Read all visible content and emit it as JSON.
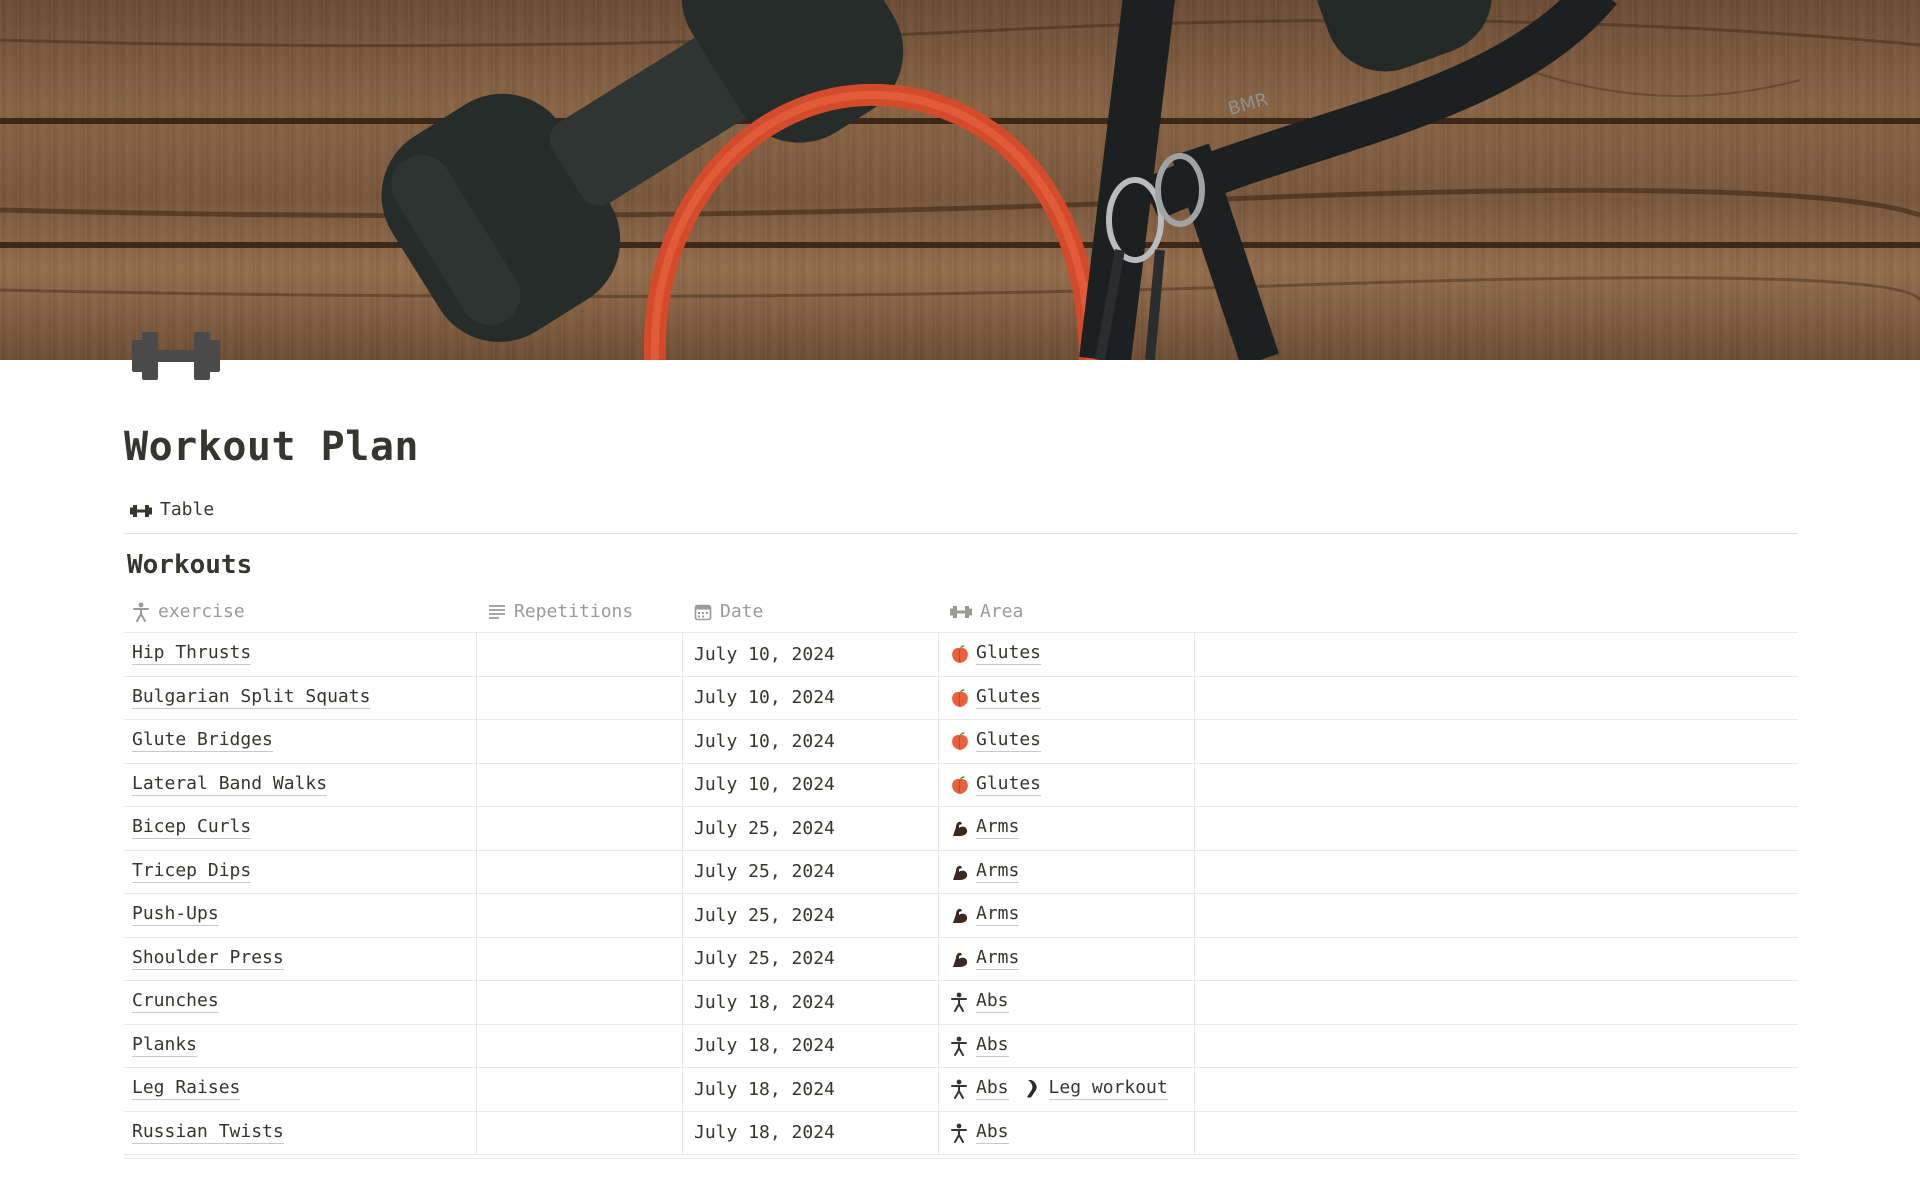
{
  "page": {
    "title": "Workout Plan",
    "icon": "dumbbell-icon",
    "cover": "dumbbells-and-resistance-band-on-wood-photo"
  },
  "views": [
    {
      "label": "Table",
      "icon": "dumbbell-icon"
    }
  ],
  "database": {
    "title": "Workouts",
    "columns": [
      {
        "label": "exercise",
        "icon": "person-icon"
      },
      {
        "label": "Repetitions",
        "icon": "text-lines-icon"
      },
      {
        "label": "Date",
        "icon": "calendar-icon"
      },
      {
        "label": "Area",
        "icon": "dumbbell-icon"
      }
    ],
    "rows": [
      {
        "exercise": "Hip Thrusts",
        "repetitions": "",
        "date": "July 10, 2024",
        "area": [
          {
            "label": "Glutes",
            "icon": "peach-icon"
          }
        ]
      },
      {
        "exercise": "Bulgarian Split Squats",
        "repetitions": "",
        "date": "July 10, 2024",
        "area": [
          {
            "label": "Glutes",
            "icon": "peach-icon"
          }
        ]
      },
      {
        "exercise": "Glute Bridges",
        "repetitions": "",
        "date": "July 10, 2024",
        "area": [
          {
            "label": "Glutes",
            "icon": "peach-icon"
          }
        ]
      },
      {
        "exercise": "Lateral Band Walks",
        "repetitions": "",
        "date": "July 10, 2024",
        "area": [
          {
            "label": "Glutes",
            "icon": "peach-icon"
          }
        ]
      },
      {
        "exercise": "Bicep Curls",
        "repetitions": "",
        "date": "July 25, 2024",
        "area": [
          {
            "label": "Arms",
            "icon": "flexed-bicep-icon"
          }
        ]
      },
      {
        "exercise": "Tricep Dips",
        "repetitions": "",
        "date": "July 25, 2024",
        "area": [
          {
            "label": "Arms",
            "icon": "flexed-bicep-icon"
          }
        ]
      },
      {
        "exercise": "Push-Ups",
        "repetitions": "",
        "date": "July 25, 2024",
        "area": [
          {
            "label": "Arms",
            "icon": "flexed-bicep-icon"
          }
        ]
      },
      {
        "exercise": "Shoulder Press",
        "repetitions": "",
        "date": "July 25, 2024",
        "area": [
          {
            "label": "Arms",
            "icon": "flexed-bicep-icon"
          }
        ]
      },
      {
        "exercise": "Crunches",
        "repetitions": "",
        "date": "July 18, 2024",
        "area": [
          {
            "label": "Abs",
            "icon": "person-icon"
          }
        ]
      },
      {
        "exercise": "Planks",
        "repetitions": "",
        "date": "July 18, 2024",
        "area": [
          {
            "label": "Abs",
            "icon": "person-icon"
          }
        ]
      },
      {
        "exercise": "Leg Raises",
        "repetitions": "",
        "date": "July 18, 2024",
        "area": [
          {
            "label": "Abs",
            "icon": "person-icon"
          },
          {
            "label": "Leg workout",
            "icon": "leg-icon"
          }
        ]
      },
      {
        "exercise": "Russian Twists",
        "repetitions": "",
        "date": "July 18, 2024",
        "area": [
          {
            "label": "Abs",
            "icon": "person-icon"
          }
        ]
      }
    ]
  },
  "colors": {
    "text": "#37352f",
    "muted": "#9b9a97",
    "divider": "#e9e9e7",
    "peach": "#e8603c",
    "bicep": "#3b2a22",
    "band": "#d9482b",
    "dumbbell": "#2c3330"
  }
}
